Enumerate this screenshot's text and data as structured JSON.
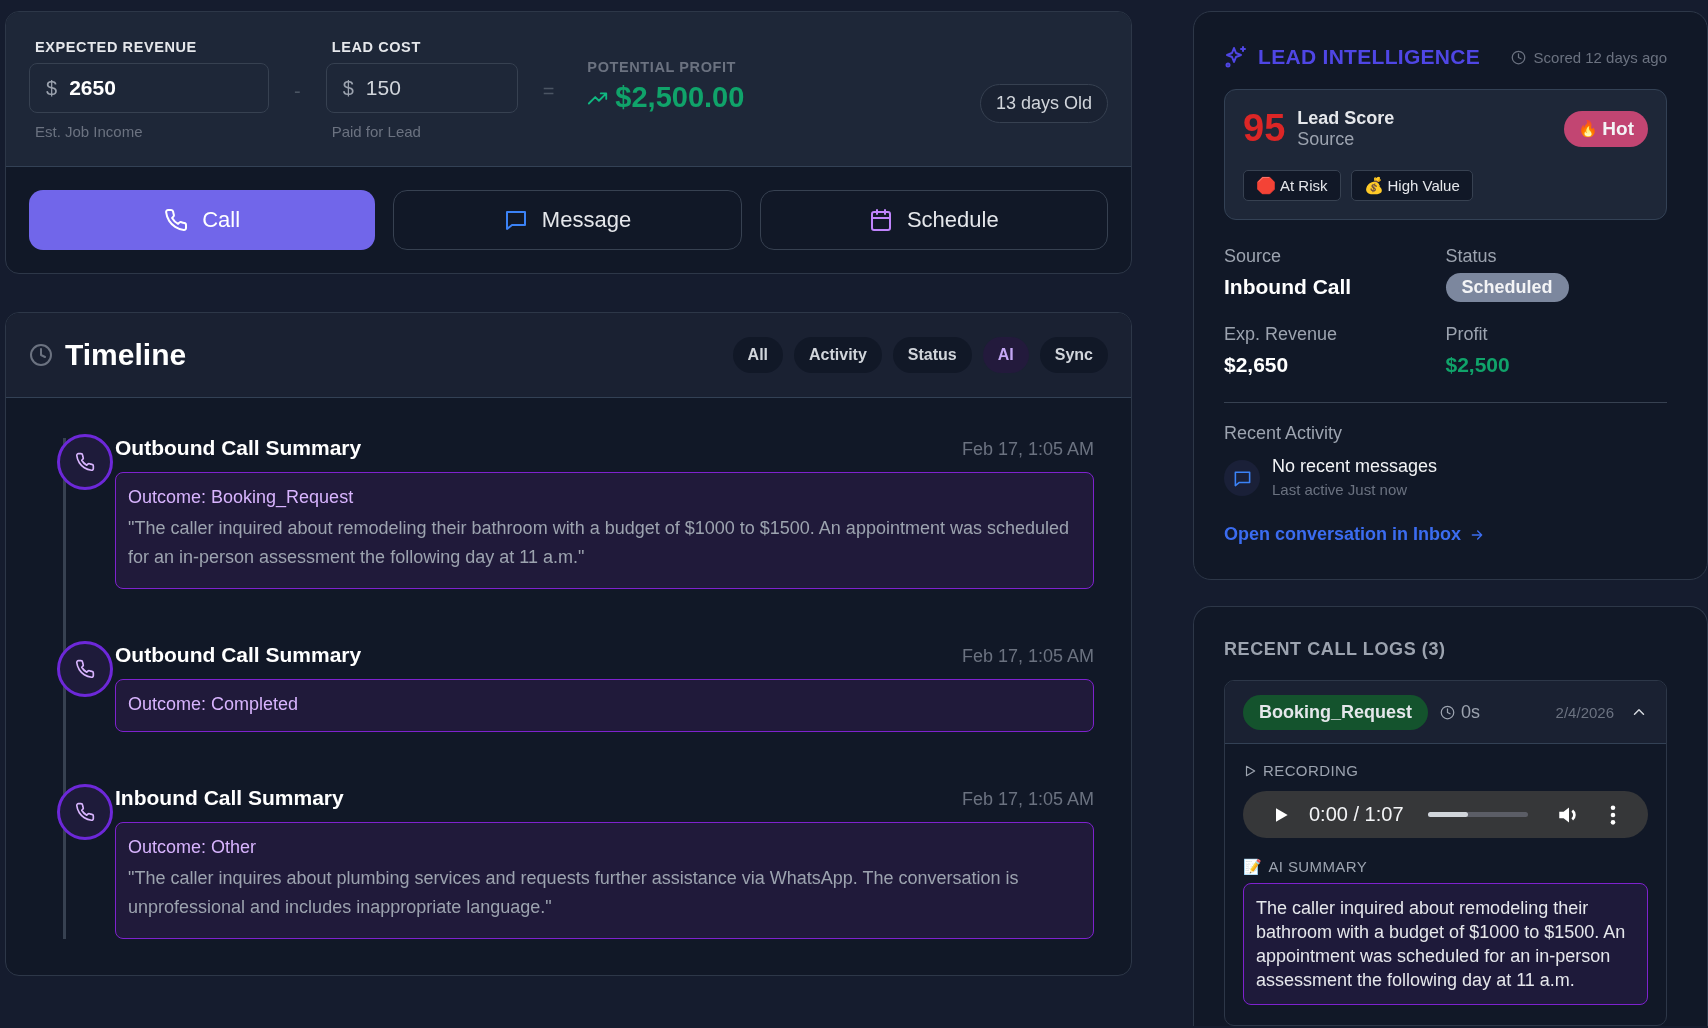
{
  "revenue": {
    "expected": {
      "label": "EXPECTED REVENUE",
      "currency": "$",
      "value": "2650",
      "hint": "Est. Job Income"
    },
    "minus": "-",
    "lead_cost": {
      "label": "LEAD COST",
      "currency": "$",
      "value": "150",
      "hint": "Paid for Lead"
    },
    "equals": "=",
    "profit": {
      "label": "POTENTIAL PROFIT",
      "value": "$2,500.00"
    },
    "age": "13 days Old"
  },
  "actions": [
    {
      "label": "Call",
      "kind": "call"
    },
    {
      "label": "Message",
      "kind": "message"
    },
    {
      "label": "Schedule",
      "kind": "schedule"
    }
  ],
  "timeline": {
    "title": "Timeline",
    "filters": [
      {
        "label": "All",
        "selected": false
      },
      {
        "label": "Activity",
        "selected": false
      },
      {
        "label": "Status",
        "selected": false
      },
      {
        "label": "AI",
        "selected": true
      },
      {
        "label": "Sync",
        "selected": false
      }
    ],
    "entries": [
      {
        "title": "Outbound Call Summary",
        "time": "Feb 17, 1:05 AM",
        "outcome": "Outcome: Booking_Request",
        "summary": "\"The caller inquired about remodeling their bathroom with a budget of $1000 to $1500. An appointment was scheduled for an in-person assessment the following day at 11 a.m.\""
      },
      {
        "title": "Outbound Call Summary",
        "time": "Feb 17, 1:05 AM",
        "outcome": "Outcome: Completed"
      },
      {
        "title": "Inbound Call Summary",
        "time": "Feb 17, 1:05 AM",
        "outcome": "Outcome: Other",
        "summary": "\"The caller inquires about plumbing services and requests further assistance via WhatsApp. The conversation is unprofessional and includes inappropriate language.\""
      }
    ]
  },
  "lead_intelligence": {
    "title": "LEAD INTELLIGENCE",
    "scored": "Scored 12 days ago",
    "score": "95",
    "score_label": "Lead Score",
    "score_sub": "Source",
    "temperature": {
      "icon": "🔥",
      "label": "Hot"
    },
    "tags": [
      {
        "icon": "🛑",
        "label": "At Risk"
      },
      {
        "icon": "💰",
        "label": "High Value"
      }
    ],
    "fields": [
      {
        "label": "Source",
        "value": "Inbound Call",
        "kind": "text"
      },
      {
        "label": "Status",
        "value": "Scheduled",
        "kind": "badge"
      },
      {
        "label": "Exp. Revenue",
        "value": "$2,650",
        "kind": "text"
      },
      {
        "label": "Profit",
        "value": "$2,500",
        "kind": "profit"
      }
    ],
    "recent_activity": {
      "label": "Recent Activity",
      "message": "No recent messages",
      "last_active": "Last active Just now"
    },
    "inbox_link": "Open conversation in Inbox"
  },
  "call_logs": {
    "title": "RECENT CALL LOGS (3)",
    "logs": [
      {
        "outcome": "Booking_Request",
        "duration": "0s",
        "date": "2/4/2026",
        "expanded": true,
        "recording_label": "RECORDING",
        "player": {
          "time": "0:00 / 1:07",
          "level": 0.4
        },
        "summary_icon": "📝",
        "summary_label": "AI SUMMARY",
        "summary": "The caller inquired about remodeling their bathroom with a budget of $1000 to $1500. An appointment was scheduled for an in-person assessment the following day at 11 a.m."
      }
    ]
  }
}
